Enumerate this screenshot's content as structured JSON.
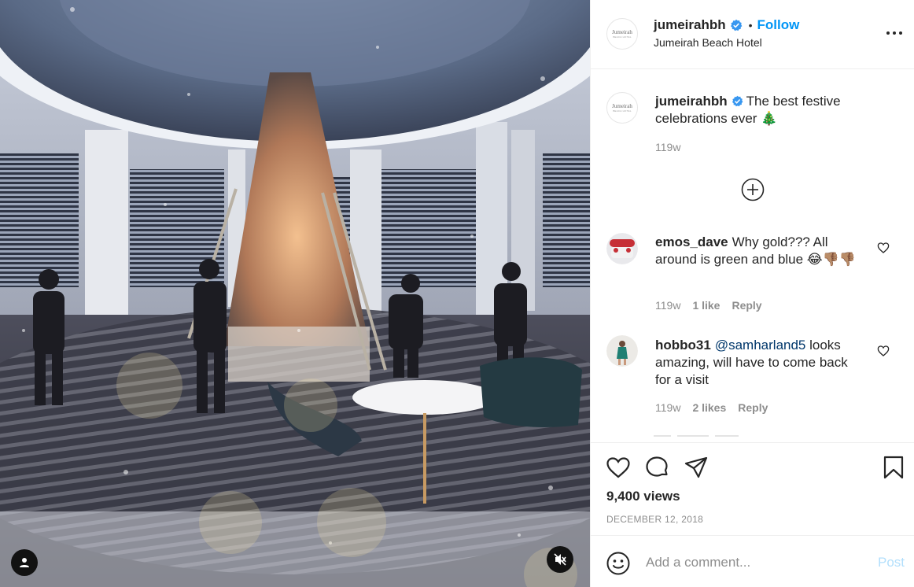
{
  "post": {
    "username": "jumeirahbh",
    "follow_label": "Follow",
    "separator": "•",
    "location": "Jumeirah Beach Hotel",
    "avatar_logo_word": "Jumeirah",
    "avatar_logo_sub": "BEACH HOTEL",
    "caption_text": "The best festive celebrations ever 🎄",
    "caption_time": "119w",
    "views": "9,400 views",
    "date": "DECEMBER 12, 2018"
  },
  "comments": [
    {
      "username": "emos_dave",
      "text": "Why gold??? All around is green and blue 😂👎🏽👎🏽",
      "time": "119w",
      "likes": "1 like",
      "reply": "Reply"
    },
    {
      "username": "hobbo31",
      "mention": "@samharland5",
      "text": "looks amazing, will have to come back for a visit",
      "time": "119w",
      "likes": "2 likes",
      "reply": "Reply"
    }
  ],
  "composer": {
    "placeholder": "Add a comment...",
    "post_label": "Post"
  },
  "colors": {
    "accent": "#0095f6",
    "verified": "#3897f0",
    "muted": "#8e8e8e",
    "post_disabled": "#b2dffc"
  },
  "icons": [
    "user-tag-icon",
    "mute-icon",
    "verified-icon",
    "more-icon",
    "load-more-icon",
    "heart-icon",
    "comment-icon",
    "share-icon",
    "bookmark-icon",
    "emoji-icon"
  ]
}
